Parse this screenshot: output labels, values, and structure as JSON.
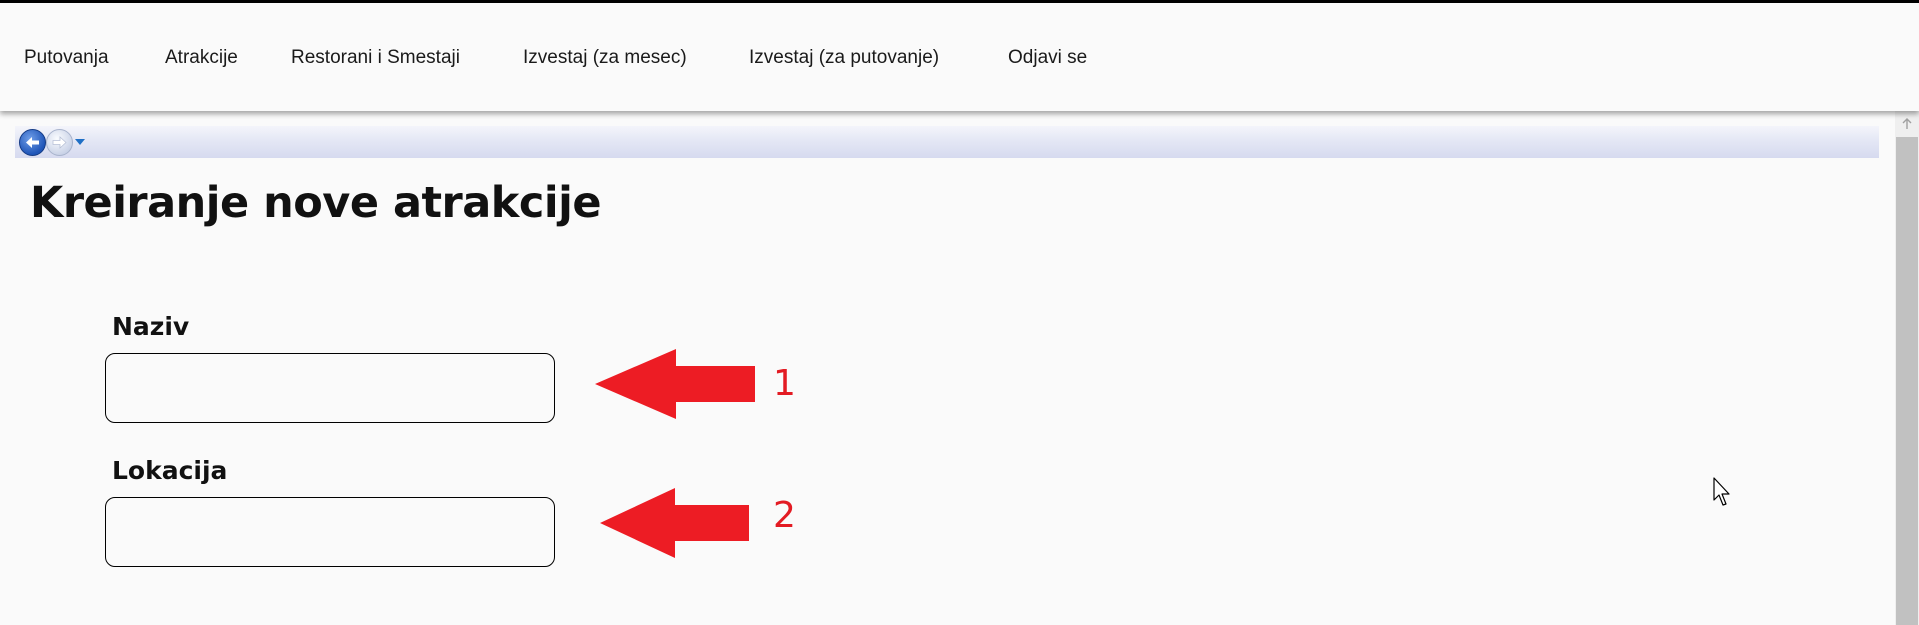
{
  "nav": {
    "items": [
      {
        "label": "Putovanja"
      },
      {
        "label": "Atrakcije"
      },
      {
        "label": "Restorani i Smestaji"
      },
      {
        "label": "Izvestaj (za mesec)"
      },
      {
        "label": "Izvestaj (za putovanje)"
      },
      {
        "label": "Odjavi se"
      }
    ]
  },
  "browser_toolbar": {
    "back_icon": "back-arrow-icon",
    "forward_icon": "forward-arrow-icon",
    "history_icon": "history-dropdown-icon"
  },
  "page": {
    "title": "Kreiranje nove atrakcije"
  },
  "form": {
    "naziv": {
      "label": "Naziv",
      "value": "",
      "placeholder": ""
    },
    "lokacija": {
      "label": "Lokacija",
      "value": "",
      "placeholder": ""
    }
  },
  "annotations": [
    {
      "number": "1",
      "color": "#e31b23"
    },
    {
      "number": "2",
      "color": "#e31b23"
    }
  ]
}
